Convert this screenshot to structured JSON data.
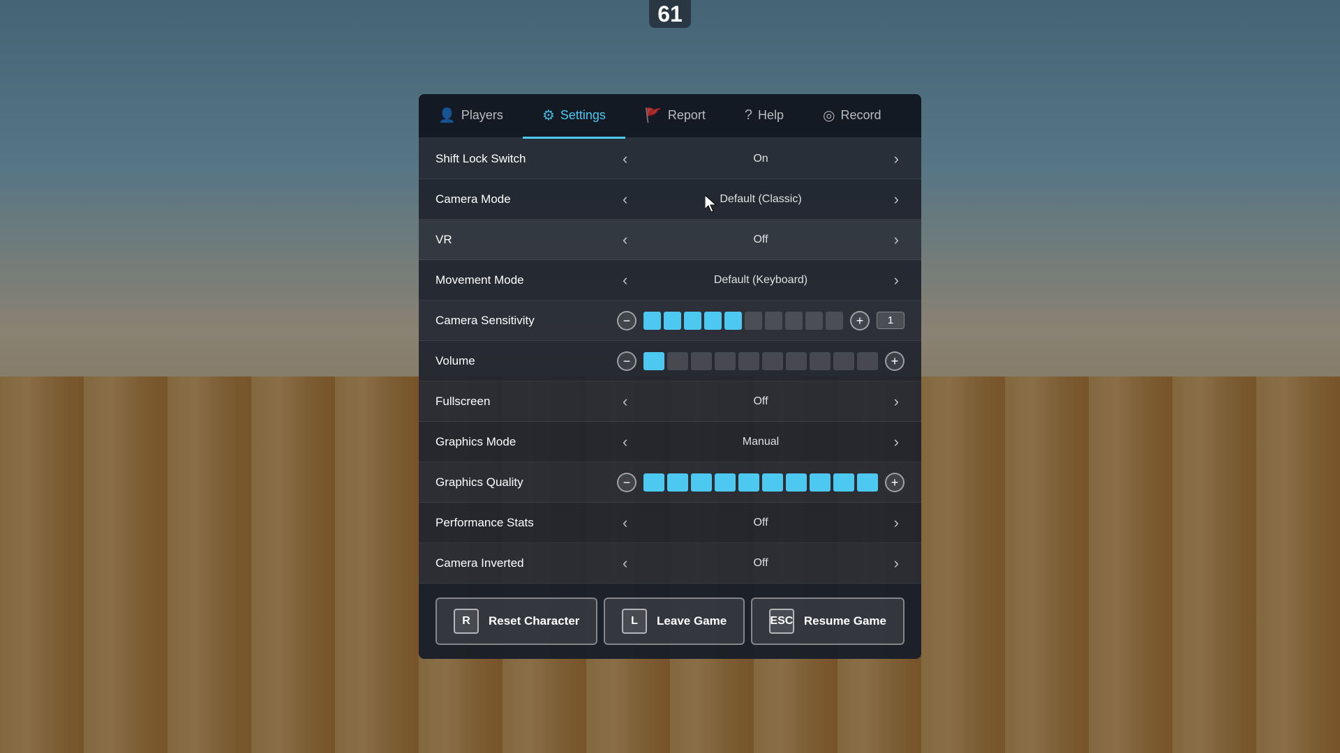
{
  "background": {
    "overlay_opacity": "0.35"
  },
  "top_number": "61",
  "tabs": [
    {
      "id": "players",
      "label": "Players",
      "icon": "👤",
      "active": false
    },
    {
      "id": "settings",
      "label": "Settings",
      "icon": "⚙",
      "active": true
    },
    {
      "id": "report",
      "label": "Report",
      "icon": "🚩",
      "active": false
    },
    {
      "id": "help",
      "label": "Help",
      "icon": "?",
      "active": false
    },
    {
      "id": "record",
      "label": "Record",
      "icon": "◎",
      "active": false
    }
  ],
  "settings": [
    {
      "id": "shift-lock",
      "label": "Shift Lock Switch",
      "type": "toggle",
      "value": "On"
    },
    {
      "id": "camera-mode",
      "label": "Camera Mode",
      "type": "toggle",
      "value": "Default (Classic)"
    },
    {
      "id": "vr",
      "label": "VR",
      "type": "toggle",
      "value": "Off",
      "highlight": true
    },
    {
      "id": "movement-mode",
      "label": "Movement Mode",
      "type": "toggle",
      "value": "Default (Keyboard)"
    },
    {
      "id": "camera-sensitivity",
      "label": "Camera Sensitivity",
      "type": "slider",
      "filled": 5,
      "total": 10,
      "number": "1"
    },
    {
      "id": "volume",
      "label": "Volume",
      "type": "slider",
      "filled": 1,
      "total": 10,
      "number": null
    },
    {
      "id": "fullscreen",
      "label": "Fullscreen",
      "type": "toggle",
      "value": "Off"
    },
    {
      "id": "graphics-mode",
      "label": "Graphics Mode",
      "type": "toggle",
      "value": "Manual"
    },
    {
      "id": "graphics-quality",
      "label": "Graphics Quality",
      "type": "slider",
      "filled": 10,
      "total": 10,
      "number": null
    },
    {
      "id": "performance-stats",
      "label": "Performance Stats",
      "type": "toggle",
      "value": "Off"
    },
    {
      "id": "camera-inverted",
      "label": "Camera Inverted",
      "type": "toggle",
      "value": "Off"
    }
  ],
  "bottom_buttons": [
    {
      "id": "reset",
      "key": "R",
      "label": "Reset Character"
    },
    {
      "id": "leave",
      "key": "L",
      "label": "Leave Game"
    },
    {
      "id": "resume",
      "key": "ESC",
      "label": "Resume Game"
    }
  ],
  "colors": {
    "accent": "#4dc8f0",
    "filled_bar": "#4dc8f0",
    "empty_bar": "rgba(255,255,255,0.15)"
  }
}
